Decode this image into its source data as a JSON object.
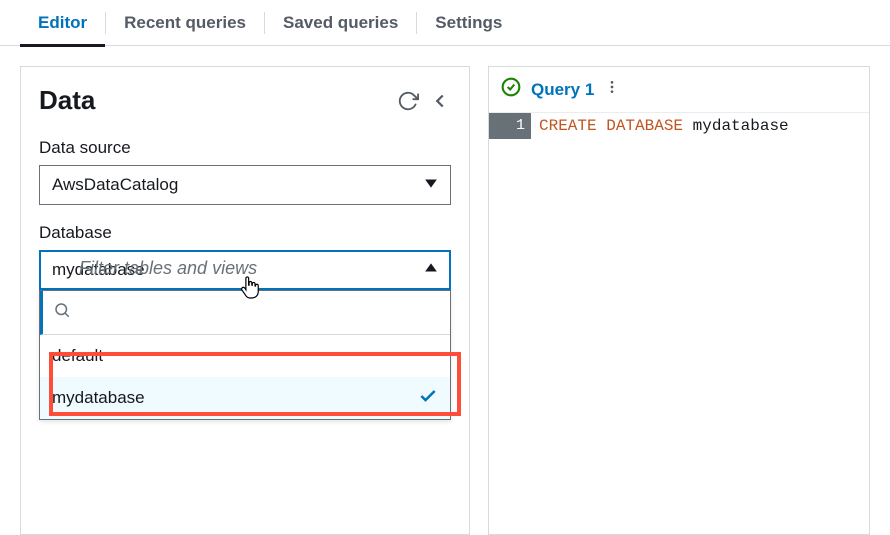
{
  "tabs": {
    "editor": "Editor",
    "recent": "Recent queries",
    "saved": "Saved queries",
    "settings": "Settings"
  },
  "sidebar": {
    "title": "Data",
    "data_source_label": "Data source",
    "data_source_value": "AwsDataCatalog",
    "database_label": "Database",
    "database_value": "mydatabase",
    "dropdown_options": {
      "opt0": "default",
      "opt1": "mydatabase"
    },
    "filter_hint": "Filter tables and views",
    "search_value": ""
  },
  "editor": {
    "query_tab": "Query 1",
    "line_number": "1",
    "code_keywords": "CREATE DATABASE",
    "code_rest": " mydatabase"
  }
}
